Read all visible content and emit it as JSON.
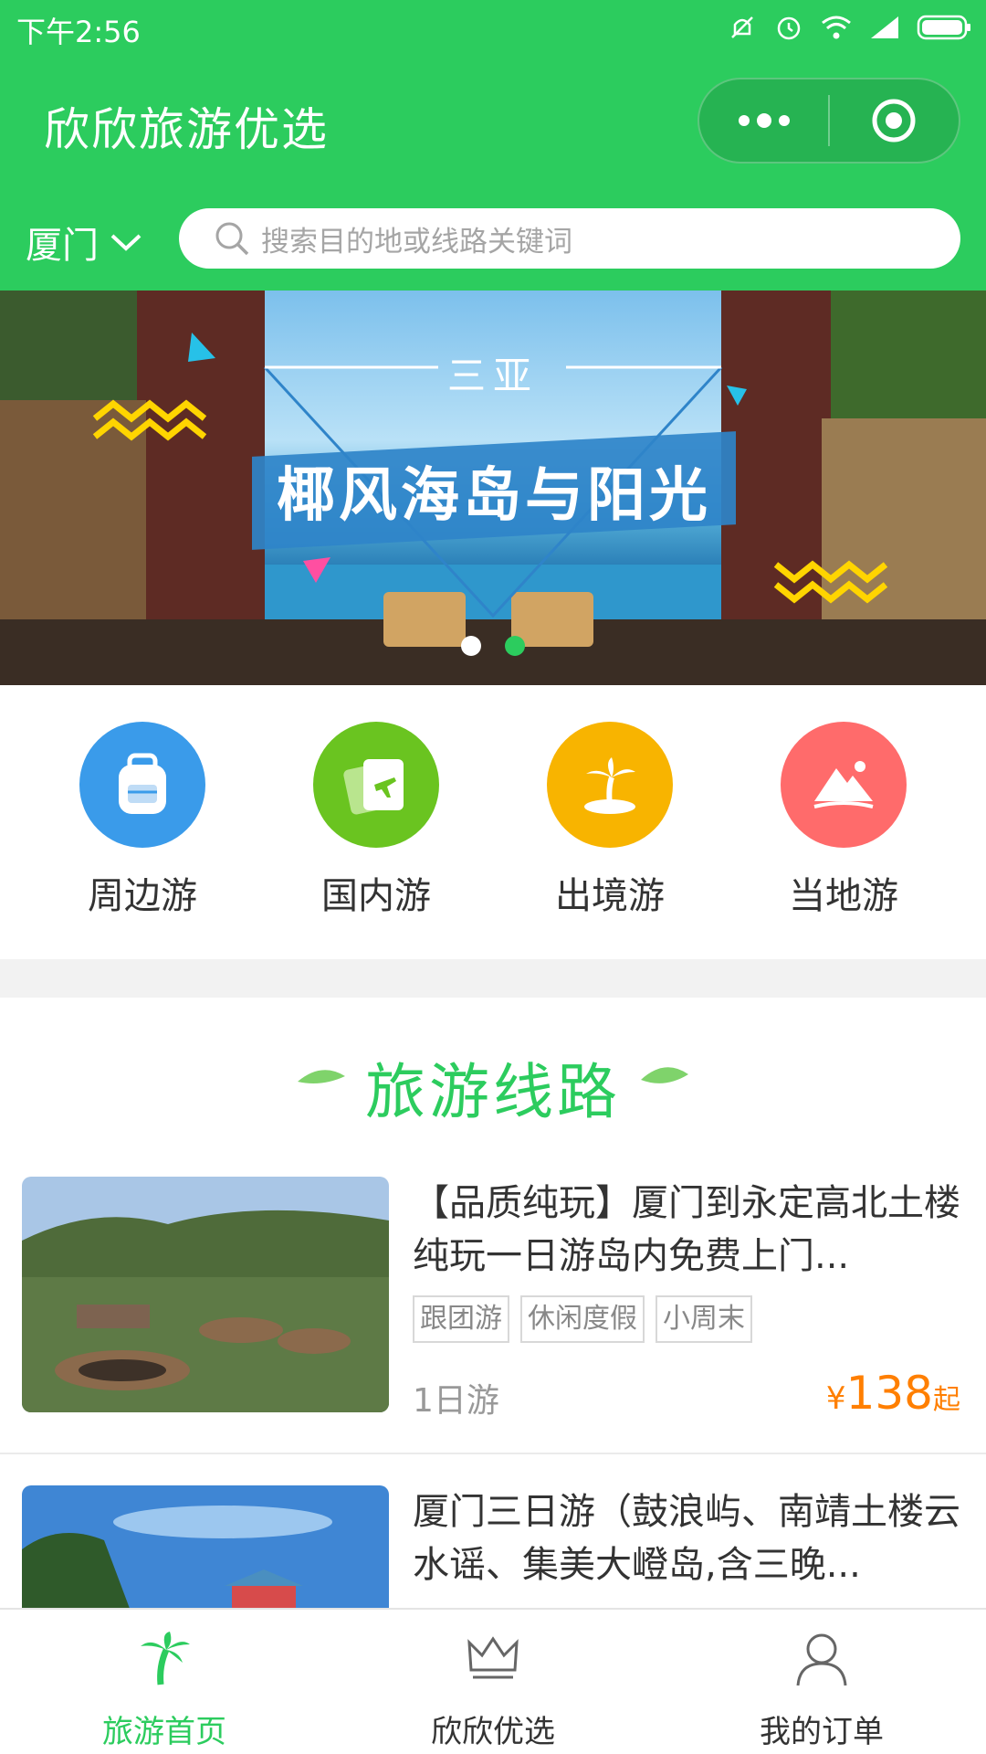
{
  "status_bar": {
    "time": "下午2:56",
    "icons": [
      "mute-icon",
      "alarm-icon",
      "wifi-icon",
      "signal-icon",
      "battery-icon"
    ]
  },
  "nav": {
    "title": "欣欣旅游优选",
    "capsule": [
      "more-icon",
      "close-target-icon"
    ]
  },
  "location": {
    "city": "厦门"
  },
  "search": {
    "placeholder": "搜索目的地或线路关键词"
  },
  "banner": {
    "subtitle": "三亚",
    "headline": "椰风海岛与阳光",
    "dots": 2,
    "active_dot": 2
  },
  "categories": [
    {
      "label": "周边游",
      "icon": "backpack-icon",
      "color": "#3a9bea"
    },
    {
      "label": "国内游",
      "icon": "ticket-plane-icon",
      "color": "#6ac420"
    },
    {
      "label": "出境游",
      "icon": "palm-island-icon",
      "color": "#f8b400"
    },
    {
      "label": "当地游",
      "icon": "mountain-icon",
      "color": "#ff6b6b"
    }
  ],
  "section": {
    "title": "旅游线路"
  },
  "routes": [
    {
      "title": "【品质纯玩】厦门到永定高北土楼纯玩一日游岛内免费上门...",
      "tags": [
        "跟团游",
        "休闲度假",
        "小周末"
      ],
      "duration": "1日游",
      "currency": "¥",
      "price": "138",
      "price_suffix": "起"
    },
    {
      "title": "厦门三日游（鼓浪屿、南靖土楼云水谣、集美大嶝岛,含三晚..."
    }
  ],
  "tabbar": {
    "items": [
      {
        "label": "旅游首页",
        "icon": "palm-tree-icon",
        "active": true
      },
      {
        "label": "欣欣优选",
        "icon": "crown-icon",
        "active": false
      },
      {
        "label": "我的订单",
        "icon": "user-icon",
        "active": false
      }
    ]
  },
  "colors": {
    "brand_green": "#2ccc5e",
    "price_orange": "#ff7f00"
  }
}
